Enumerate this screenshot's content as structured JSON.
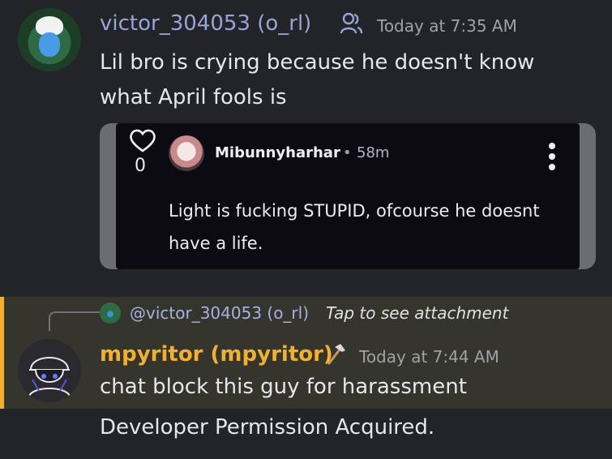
{
  "message1": {
    "author": "victor_304053 (o_rl)",
    "timestamp": "Today at 7:35 AM",
    "text": "Lil bro is crying because he doesn't know what April fools is",
    "embed": {
      "likes": "0",
      "username": "Mibunnyharhar",
      "separator": "•",
      "age": "58m",
      "body": "Light is fucking STUPID, ofcourse he doesnt have a life."
    }
  },
  "message2": {
    "reply_to": "@victor_304053 (o_rl)",
    "reply_attachment_text": "Tap to see attachment",
    "author": "mpyritor (mpyritor)",
    "timestamp": "Today at 7:44 AM",
    "text": "chat block this guy for harassment"
  },
  "message3": {
    "text": "Developer Permission Acquired."
  },
  "colors": {
    "background": "#232428",
    "highlight_bg": "#35352e",
    "highlight_bar": "#f0b132",
    "username_blue": "#9aa3d8",
    "username_gold": "#f0b132"
  },
  "icons": {
    "author1_badge": "users-icon",
    "like": "heart-icon",
    "more": "kebab-icon",
    "author2_badge": "hammer-icon"
  }
}
